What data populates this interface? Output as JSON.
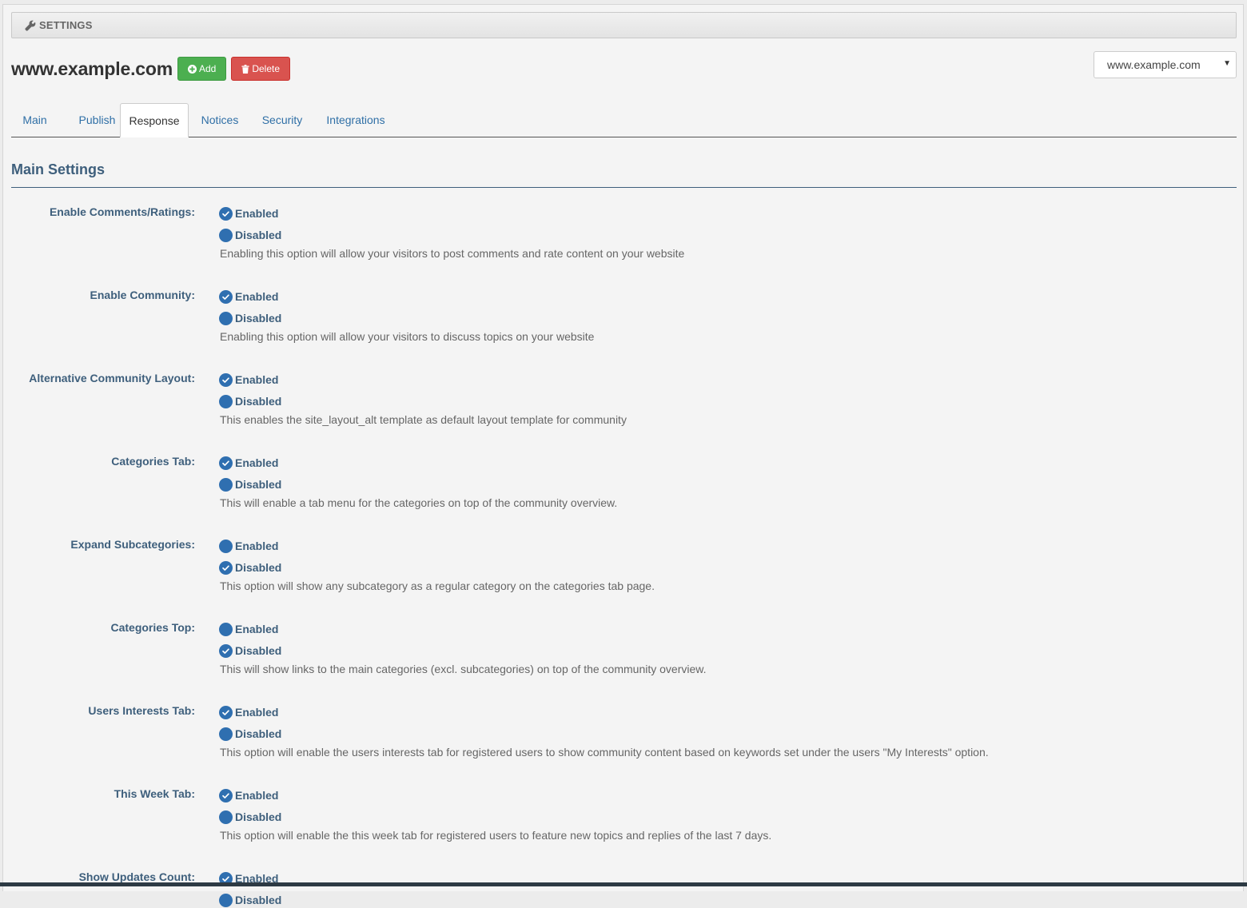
{
  "header": {
    "title": "SETTINGS",
    "icon": "wrench-icon"
  },
  "site": {
    "title": "www.example.com",
    "add_label": "Add",
    "delete_label": "Delete",
    "select_value": "www.example.com"
  },
  "tabs": [
    {
      "label": "Main",
      "active": false
    },
    {
      "label": "Publish",
      "active": false
    },
    {
      "label": "Response",
      "active": true
    },
    {
      "label": "Notices",
      "active": false
    },
    {
      "label": "Security",
      "active": false
    },
    {
      "label": "Integrations",
      "active": false
    }
  ],
  "section": {
    "title": "Main Settings"
  },
  "settings": [
    {
      "label": "Enable Comments/Ratings:",
      "enabled_label": "Enabled",
      "disabled_label": "Disabled",
      "value": "enabled",
      "description": "Enabling this option will allow your visitors to post comments and rate content on your website"
    },
    {
      "label": "Enable Community:",
      "enabled_label": "Enabled",
      "disabled_label": "Disabled",
      "value": "enabled",
      "description": "Enabling this option will allow your visitors to discuss topics on your website"
    },
    {
      "label": "Alternative Community Layout:",
      "enabled_label": "Enabled",
      "disabled_label": "Disabled",
      "value": "enabled",
      "description": "This enables the site_layout_alt template as default layout template for community"
    },
    {
      "label": "Categories Tab:",
      "enabled_label": "Enabled",
      "disabled_label": "Disabled",
      "value": "enabled",
      "description": "This will enable a tab menu for the categories on top of the community overview."
    },
    {
      "label": "Expand Subcategories:",
      "enabled_label": "Enabled",
      "disabled_label": "Disabled",
      "value": "disabled",
      "description": "This option will show any subcategory as a regular category on the categories tab page."
    },
    {
      "label": "Categories Top:",
      "enabled_label": "Enabled",
      "disabled_label": "Disabled",
      "value": "disabled",
      "description": "This will show links to the main categories (excl. subcategories) on top of the community overview."
    },
    {
      "label": "Users Interests Tab:",
      "enabled_label": "Enabled",
      "disabled_label": "Disabled",
      "value": "enabled",
      "description": "This option will enable the users interests tab for registered users to show community content based on keywords set under the users \"My Interests\" option."
    },
    {
      "label": "This Week Tab:",
      "enabled_label": "Enabled",
      "disabled_label": "Disabled",
      "value": "enabled",
      "description": "This option will enable the this week tab for registered users to feature new topics and replies of the last 7 days."
    },
    {
      "label": "Show Updates Count:",
      "enabled_label": "Enabled",
      "disabled_label": "Disabled",
      "value": "enabled",
      "description": ""
    }
  ],
  "colors": {
    "accent": "#2f6fb0",
    "label": "#3e5f7c",
    "add": "#4caf50",
    "delete": "#d9534f"
  }
}
